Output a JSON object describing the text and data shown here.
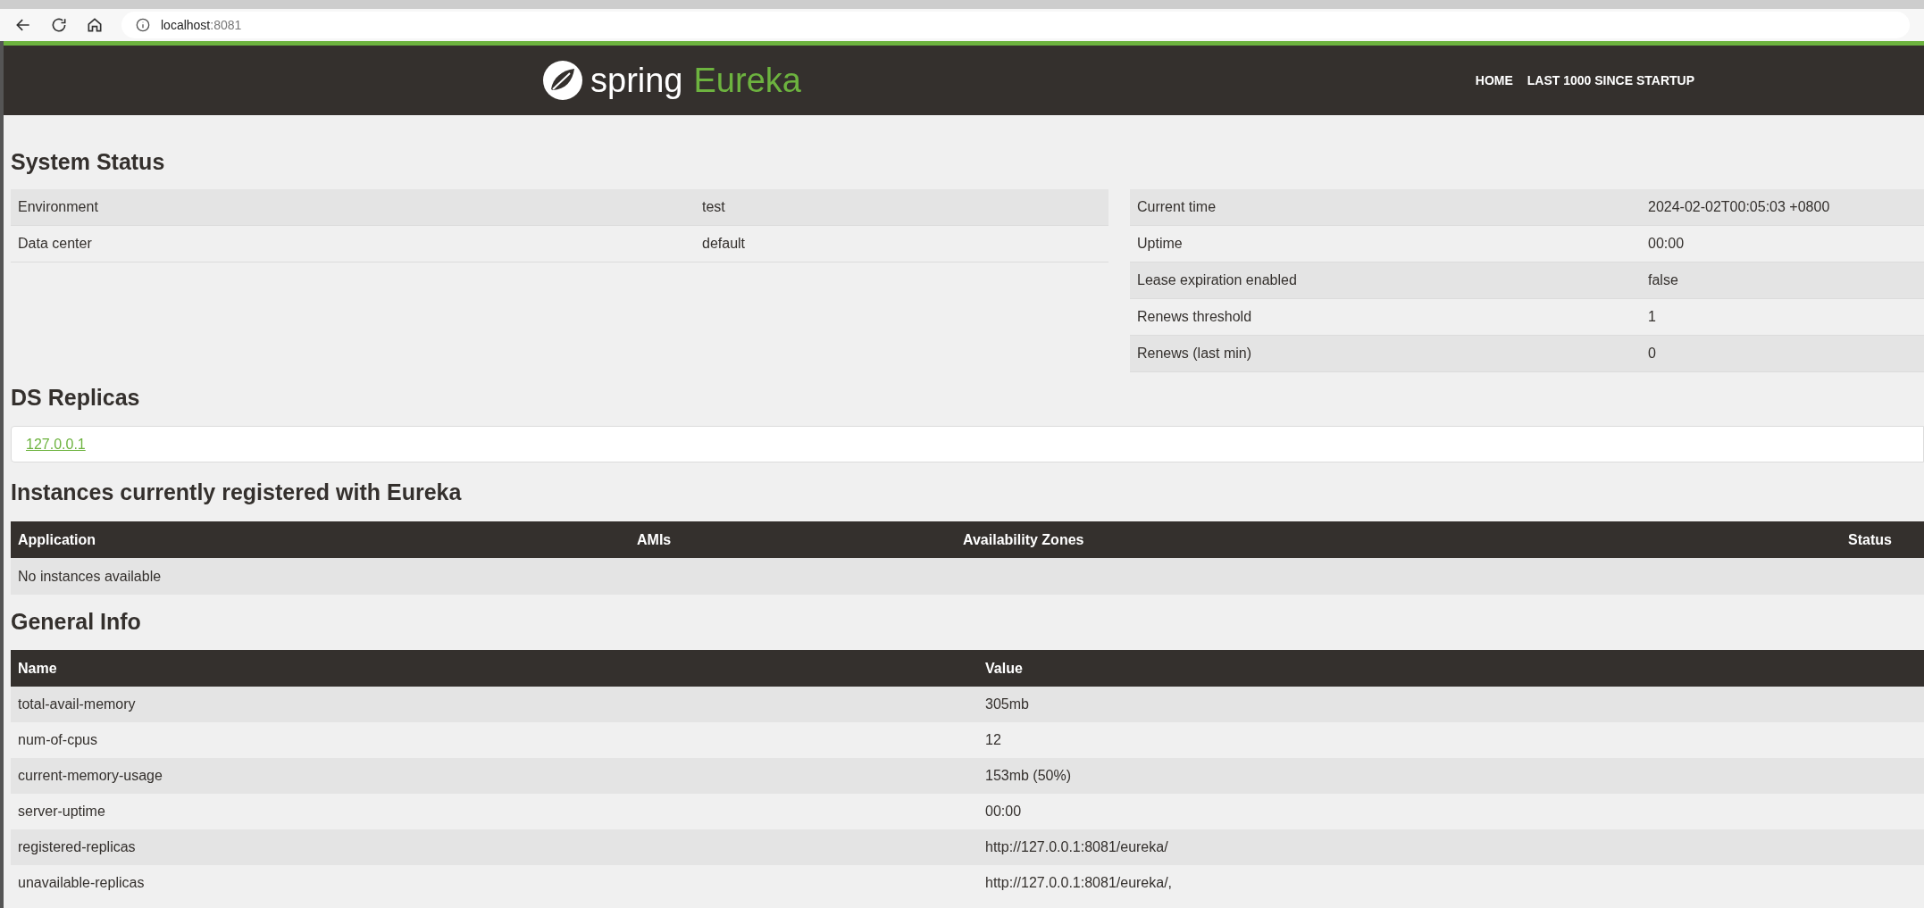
{
  "browser": {
    "address_host": "localhost",
    "address_port": ":8081"
  },
  "header": {
    "logo_word": "spring",
    "logo_product": "Eureka",
    "nav": [
      "HOME",
      "LAST 1000 SINCE STARTUP"
    ]
  },
  "system_status": {
    "title": "System Status",
    "left_rows": [
      {
        "label": "Environment",
        "value": "test"
      },
      {
        "label": "Data center",
        "value": "default"
      }
    ],
    "right_rows": [
      {
        "label": "Current time",
        "value": "2024-02-02T00:05:03 +0800"
      },
      {
        "label": "Uptime",
        "value": "00:00"
      },
      {
        "label": "Lease expiration enabled",
        "value": "false"
      },
      {
        "label": "Renews threshold",
        "value": "1"
      },
      {
        "label": "Renews (last min)",
        "value": "0"
      }
    ]
  },
  "ds_replicas": {
    "title": "DS Replicas",
    "replicas": [
      "127.0.0.1"
    ]
  },
  "instances": {
    "title": "Instances currently registered with Eureka",
    "columns": [
      "Application",
      "AMIs",
      "Availability Zones",
      "Status"
    ],
    "empty_message": "No instances available"
  },
  "general_info": {
    "title": "General Info",
    "columns": [
      "Name",
      "Value"
    ],
    "rows": [
      {
        "name": "total-avail-memory",
        "value": "305mb"
      },
      {
        "name": "num-of-cpus",
        "value": "12"
      },
      {
        "name": "current-memory-usage",
        "value": "153mb (50%)"
      },
      {
        "name": "server-uptime",
        "value": "00:00"
      },
      {
        "name": "registered-replicas",
        "value": "http://127.0.0.1:8081/eureka/"
      },
      {
        "name": "unavailable-replicas",
        "value": "http://127.0.0.1:8081/eureka/,"
      }
    ]
  }
}
